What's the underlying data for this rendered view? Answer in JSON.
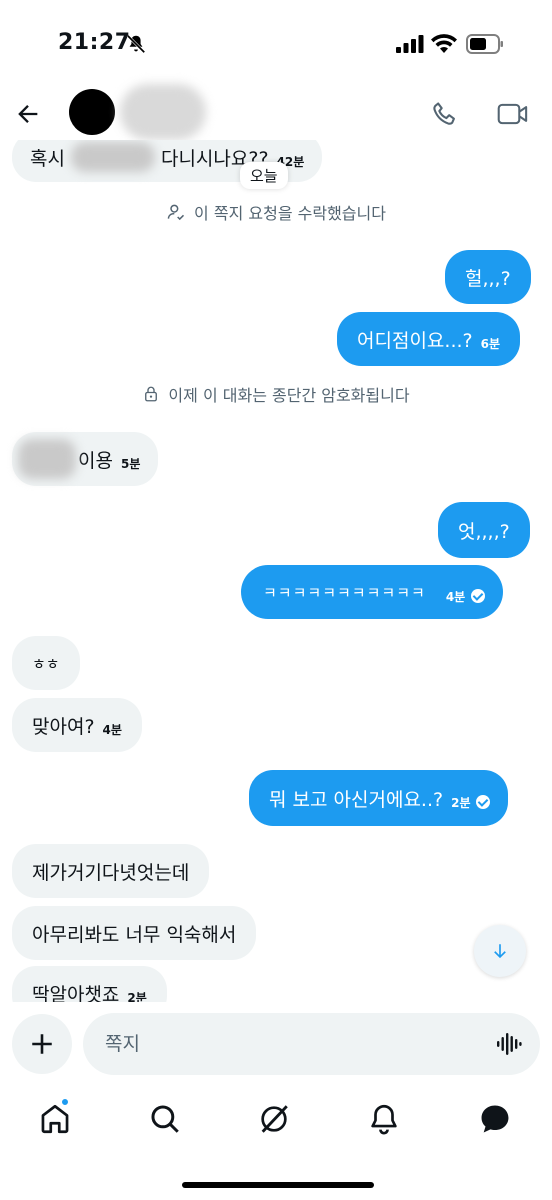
{
  "status": {
    "time": "21:27"
  },
  "chat": {
    "today_label": "오늘",
    "accepted_text": "이 쪽지 요청을 수락했습니다",
    "encrypted_text": "이제 이 대화는 종단간 암호화됩니다",
    "messages": [
      {
        "dir": "in",
        "pre": "혹시",
        "post": "다니시나요??",
        "time": "42분"
      },
      {
        "dir": "out",
        "text": "헐,,,?"
      },
      {
        "dir": "out",
        "text": "어디점이요...?",
        "time": "6분"
      },
      {
        "dir": "in",
        "post": "이용",
        "time": "5분"
      },
      {
        "dir": "out",
        "text": "엇,,,,?"
      },
      {
        "dir": "out",
        "text": "ㅋㅋㅋㅋㅋㅋㅋㅋㅋㅋㅋ",
        "time": "4분"
      },
      {
        "dir": "in",
        "text": "ㅎㅎ"
      },
      {
        "dir": "in",
        "text": "맞아여?",
        "time": "4분"
      },
      {
        "dir": "out",
        "text": "뭐 보고 아신거에요..?",
        "time": "2분"
      },
      {
        "dir": "in",
        "text": "제가거기다녓엇는데"
      },
      {
        "dir": "in",
        "text": "아무리봐도 너무 익숙해서"
      },
      {
        "dir": "in",
        "text": "딱알아챗죠",
        "time": "2분"
      }
    ]
  },
  "composer": {
    "placeholder": "쪽지"
  },
  "colors": {
    "accent": "#1d9bf0",
    "incoming_bg": "#eff3f4",
    "muted": "#536471"
  },
  "icons": [
    "back-arrow-icon",
    "phone-icon",
    "video-icon",
    "plus-icon",
    "voice-icon",
    "home-icon",
    "search-icon",
    "grok-icon",
    "bell-icon",
    "messages-icon",
    "arrow-down-icon"
  ]
}
